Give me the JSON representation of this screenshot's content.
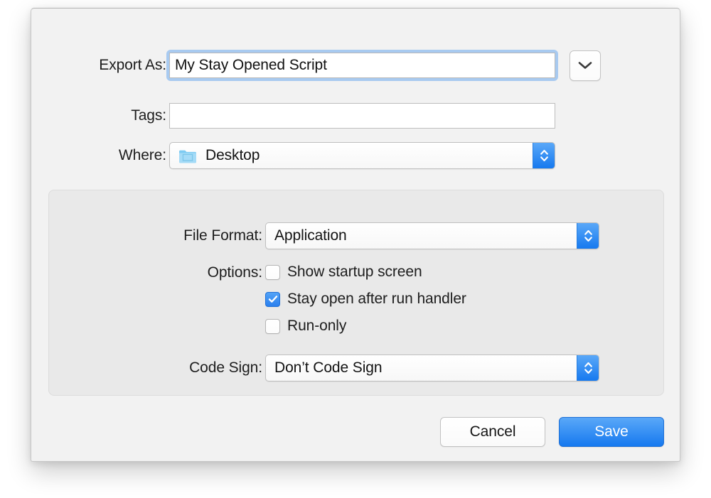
{
  "dialog": {
    "type": "export-save-sheet",
    "accent_color": "#1679ef",
    "sheet_background": "#f2f2f2",
    "panel_background": "#e9e9e9"
  },
  "fields": {
    "export_as": {
      "label": "Export As:",
      "value": "My Stay Opened Script",
      "placeholder": "",
      "focused": true,
      "disclosure_icon": "chevron-down-icon"
    },
    "tags": {
      "label": "Tags:",
      "value": "",
      "placeholder": ""
    },
    "where": {
      "label": "Where:",
      "value": "Desktop",
      "icon": "folder-icon",
      "arrows_icon": "chevron-up-down-icon"
    }
  },
  "panel": {
    "file_format": {
      "label": "File Format:",
      "value": "Application",
      "arrows_icon": "chevron-up-down-icon"
    },
    "options": {
      "label": "Options:",
      "items": [
        {
          "label": "Show startup screen",
          "checked": false
        },
        {
          "label": "Stay open after run handler",
          "checked": true
        },
        {
          "label": "Run-only",
          "checked": false
        }
      ]
    },
    "code_sign": {
      "label": "Code Sign:",
      "value": "Don’t Code Sign",
      "arrows_icon": "chevron-up-down-icon"
    }
  },
  "footer": {
    "cancel_label": "Cancel",
    "save_label": "Save"
  }
}
